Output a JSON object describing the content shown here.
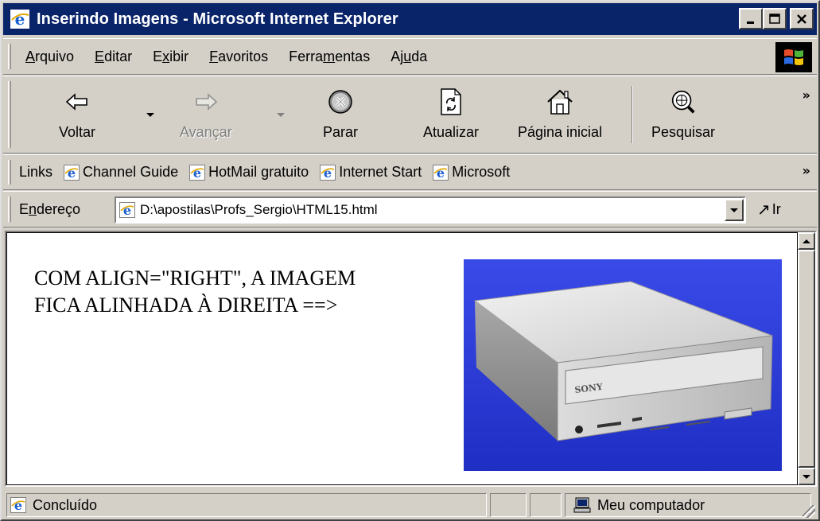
{
  "window": {
    "title": "Inserindo Imagens - Microsoft Internet Explorer",
    "min_glyph": "_",
    "max_glyph": "□",
    "close_glyph": "✕"
  },
  "menu": {
    "items": [
      {
        "pre": "",
        "u": "A",
        "post": "rquivo"
      },
      {
        "pre": "",
        "u": "E",
        "post": "ditar"
      },
      {
        "pre": "E",
        "u": "x",
        "post": "ibir"
      },
      {
        "pre": "",
        "u": "F",
        "post": "avoritos"
      },
      {
        "pre": "Ferra",
        "u": "m",
        "post": "entas"
      },
      {
        "pre": "Aj",
        "u": "u",
        "post": "da"
      }
    ]
  },
  "toolbar": {
    "back": "Voltar",
    "forward": "Avançar",
    "stop": "Parar",
    "refresh": "Atualizar",
    "home": "Página inicial",
    "search": "Pesquisar",
    "more": "»"
  },
  "links": {
    "label": "Links",
    "items": [
      "Channel Guide",
      "HotMail gratuito",
      "Internet Start",
      "Microsoft"
    ],
    "more": "»"
  },
  "address": {
    "label_pre": "E",
    "label_u": "n",
    "label_post": "dereço",
    "value": "D:\\apostilas\\Profs_Sergio\\HTML15.html",
    "go": "Ir"
  },
  "page": {
    "text_line1": "COM ALIGN=\"RIGHT\", A IMAGEM",
    "text_line2": "FICA ALINHADA À DIREITA ==>",
    "image_brand": "SONY"
  },
  "status": {
    "text": "Concluído",
    "zone": "Meu computador"
  },
  "colors": {
    "titlebar": "#0a246a",
    "chrome": "#d4d0c8",
    "image_bg": "#2a3bd6"
  }
}
